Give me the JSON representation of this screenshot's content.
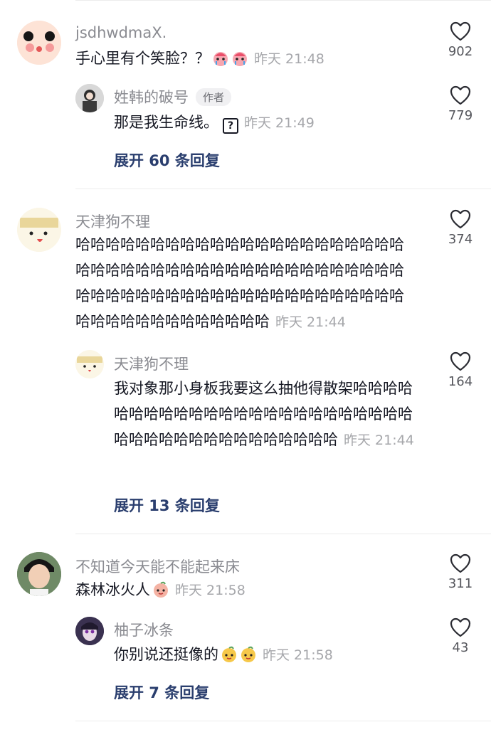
{
  "comments": [
    {
      "user": "jsdhwdmaX.",
      "text": "手心里有个笑脸？？",
      "time": "昨天 21:48",
      "likes": "902",
      "replies": [
        {
          "user": "姓韩的破号",
          "tag": "作者",
          "text": "那是我生命线。",
          "time": "昨天 21:49",
          "likes": "779"
        }
      ],
      "expand": "展开 60 条回复"
    },
    {
      "user": "天津狗不理",
      "text": "哈哈哈哈哈哈哈哈哈哈哈哈哈哈哈哈哈哈哈哈哈哈哈哈哈哈哈哈哈哈哈哈哈哈哈哈哈哈哈哈哈哈哈哈哈哈哈哈哈哈哈哈哈哈哈哈哈哈哈哈哈哈哈哈哈哈哈哈哈哈哈哈哈哈哈哈哈哈哈",
      "time": "昨天 21:44",
      "likes": "374",
      "replies": [
        {
          "user": "天津狗不理",
          "text": "我对象那小身板我要这么抽他得散架哈哈哈哈哈哈哈哈哈哈哈哈哈哈哈哈哈哈哈哈哈哈哈哈哈哈哈哈哈哈哈哈哈哈哈哈哈哈哈",
          "time": "昨天 21:44",
          "likes": "164"
        }
      ],
      "expand": "展开 13 条回复"
    },
    {
      "user": "不知道今天能不能起来床",
      "text": "森林冰火人",
      "time": "昨天 21:58",
      "likes": "311",
      "replies": [
        {
          "user": "柚子冰条",
          "text": "你别说还挺像的",
          "time": "昨天 21:58",
          "likes": "43"
        }
      ],
      "expand": "展开 7 条回复"
    }
  ],
  "icons": {
    "like": "heart-outline-icon"
  },
  "colors": {
    "text": "#161823",
    "muted": "#8a8b91",
    "link": "#2a3e6e"
  }
}
